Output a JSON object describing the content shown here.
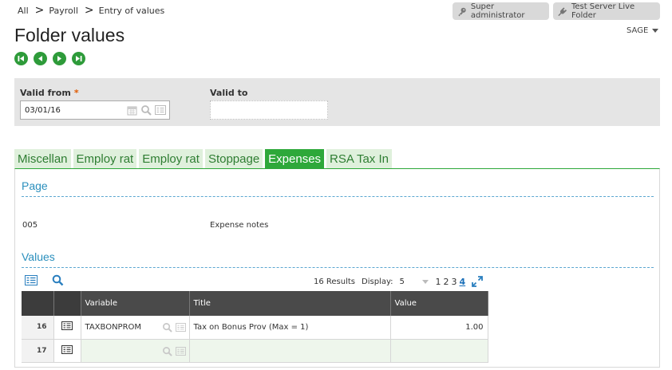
{
  "breadcrumb": [
    "All",
    "Payroll",
    "Entry of values"
  ],
  "breadcrumb_separator": ">",
  "header": {
    "user_button": "Super administrator",
    "folder_button": "Test Server Live Folder",
    "company_menu": "SAGE"
  },
  "page_title": "Folder values",
  "filters": {
    "valid_from_label": "Valid from",
    "required_marker": "*",
    "valid_from_value": "03/01/16",
    "valid_to_label": "Valid to",
    "valid_to_value": ""
  },
  "tabs": [
    {
      "label": "Miscellan",
      "active": false
    },
    {
      "label": "Employ rat",
      "active": false
    },
    {
      "label": "Employ rat",
      "active": false
    },
    {
      "label": "Stoppage",
      "active": false
    },
    {
      "label": "Expenses",
      "active": true
    },
    {
      "label": "RSA Tax In",
      "active": false
    }
  ],
  "page_section": {
    "title": "Page",
    "code": "005",
    "description": "Expense notes"
  },
  "values_section": {
    "title": "Values",
    "results_text": "16 Results",
    "display_label": "Display:",
    "display_value": "5",
    "pages": [
      "1",
      "2",
      "3",
      "4"
    ],
    "current_page": "4",
    "columns": [
      "Variable",
      "Title",
      "Value"
    ],
    "rows": [
      {
        "num": "16",
        "variable": "TAXBONPROM",
        "title": "Tax on Bonus Prov (Max = 1)",
        "value": "1.00"
      },
      {
        "num": "17",
        "variable": "",
        "title": "",
        "value": ""
      }
    ]
  },
  "colors": {
    "accent_green": "#2ea83a",
    "tab_inactive_bg": "#dff0dc",
    "section_blue": "#2a8fbd",
    "grid_header": "#4a4a4a"
  },
  "icons": {
    "user_button": "key-icon",
    "folder_button": "plug-icon",
    "nav": [
      "first-record-icon",
      "previous-record-icon",
      "next-record-icon",
      "last-record-icon"
    ]
  }
}
